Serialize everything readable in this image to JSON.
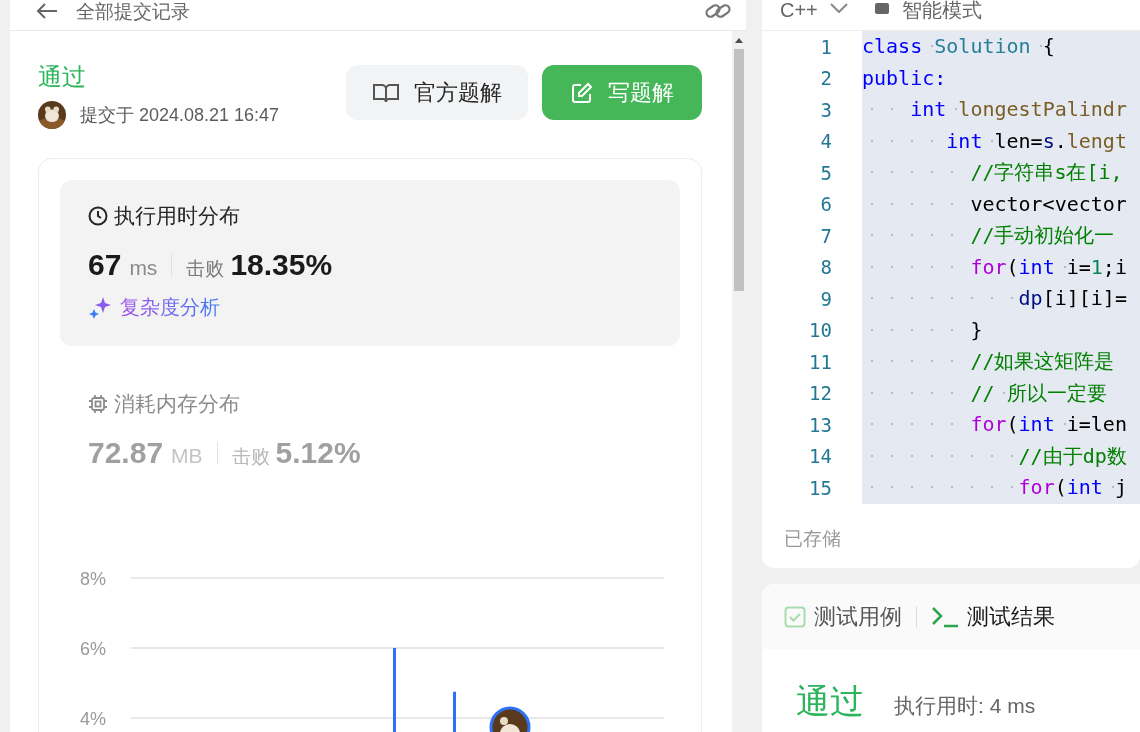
{
  "header": {
    "title": "全部提交记录"
  },
  "submission": {
    "status": "通过",
    "submitted": "提交于 2024.08.21 16:47"
  },
  "buttons": [
    {
      "label": "官方题解",
      "kind": "secondary"
    },
    {
      "label": "写题解",
      "kind": "primary"
    }
  ],
  "distributions": [
    {
      "kind": "time",
      "title": "执行用时分布",
      "value": "67",
      "unit": "ms",
      "beats_label": "击败",
      "beats": "18.35%",
      "link": "复杂度分析",
      "selected": true
    },
    {
      "kind": "memory",
      "title": "消耗内存分布",
      "value": "72.87",
      "unit": "MB",
      "beats_label": "击败",
      "beats": "5.12%",
      "selected": false
    }
  ],
  "chart_data": {
    "type": "bar",
    "values": [
      6,
      4.75
    ],
    "grid": true,
    "ylim": [
      3.46,
      8
    ],
    "yticks": [
      {
        "value": 4,
        "label": "4%"
      },
      {
        "value": 6,
        "label": "6%"
      },
      {
        "value": 8,
        "label": "8%"
      }
    ]
  },
  "editor": {
    "language": "C++",
    "mode": "智能模式",
    "saved": "已存储",
    "lines": [
      {
        "number": "1",
        "tokens": [
          {
            "kind": "keyword",
            "text": "class"
          },
          {
            "kind": "type",
            "text": " Solution"
          },
          {
            "kind": "plain",
            "text": " {"
          }
        ]
      },
      {
        "number": "2",
        "tokens": [
          {
            "kind": "keyword",
            "text": "public:"
          }
        ]
      },
      {
        "number": "3",
        "tokens": [
          {
            "kind": "keyword",
            "text": "    int"
          },
          {
            "kind": "func",
            "text": " longestPalindr"
          }
        ]
      },
      {
        "number": "4",
        "tokens": [
          {
            "kind": "keyword",
            "text": "       int"
          },
          {
            "kind": "plain",
            "text": " len="
          },
          {
            "kind": "var",
            "text": "s"
          },
          {
            "kind": "plain",
            "text": "."
          },
          {
            "kind": "func",
            "text": "lengt"
          }
        ]
      },
      {
        "number": "5",
        "tokens": [
          {
            "kind": "comment",
            "text": "         //字符串s在[i,"
          }
        ]
      },
      {
        "number": "6",
        "tokens": [
          {
            "kind": "plain",
            "text": "         vector<vector"
          }
        ]
      },
      {
        "number": "7",
        "tokens": [
          {
            "kind": "comment",
            "text": "         //手动初始化一"
          }
        ]
      },
      {
        "number": "8",
        "tokens": [
          {
            "kind": "control",
            "text": "         for"
          },
          {
            "kind": "plain",
            "text": "("
          },
          {
            "kind": "keyword",
            "text": "int"
          },
          {
            "kind": "plain",
            "text": " i="
          },
          {
            "kind": "number",
            "text": "1"
          },
          {
            "kind": "plain",
            "text": ";i"
          }
        ]
      },
      {
        "number": "9",
        "tokens": [
          {
            "kind": "var",
            "text": "             dp"
          },
          {
            "kind": "plain",
            "text": "[i][i]="
          }
        ]
      },
      {
        "number": "10",
        "tokens": [
          {
            "kind": "plain",
            "text": "         }"
          }
        ]
      },
      {
        "number": "11",
        "tokens": [
          {
            "kind": "comment",
            "text": "         //如果这矩阵是"
          }
        ]
      },
      {
        "number": "12",
        "tokens": [
          {
            "kind": "comment",
            "text": "         // 所以一定要"
          }
        ]
      },
      {
        "number": "13",
        "tokens": [
          {
            "kind": "control",
            "text": "         for"
          },
          {
            "kind": "plain",
            "text": "("
          },
          {
            "kind": "keyword",
            "text": "int"
          },
          {
            "kind": "plain",
            "text": " i=len"
          }
        ]
      },
      {
        "number": "14",
        "tokens": [
          {
            "kind": "comment",
            "text": "             //由于dp数"
          }
        ]
      },
      {
        "number": "15",
        "tokens": [
          {
            "kind": "control",
            "text": "             for"
          },
          {
            "kind": "plain",
            "text": "("
          },
          {
            "kind": "keyword",
            "text": "int"
          },
          {
            "kind": "plain",
            "text": " j"
          }
        ]
      }
    ]
  },
  "result_tabs": [
    {
      "label": "测试用例",
      "kind": "cases",
      "selected": false
    },
    {
      "label": "测试结果",
      "kind": "results",
      "selected": true
    }
  ],
  "result": {
    "status": "通过",
    "runtime": "执行用时: 4 ms"
  }
}
